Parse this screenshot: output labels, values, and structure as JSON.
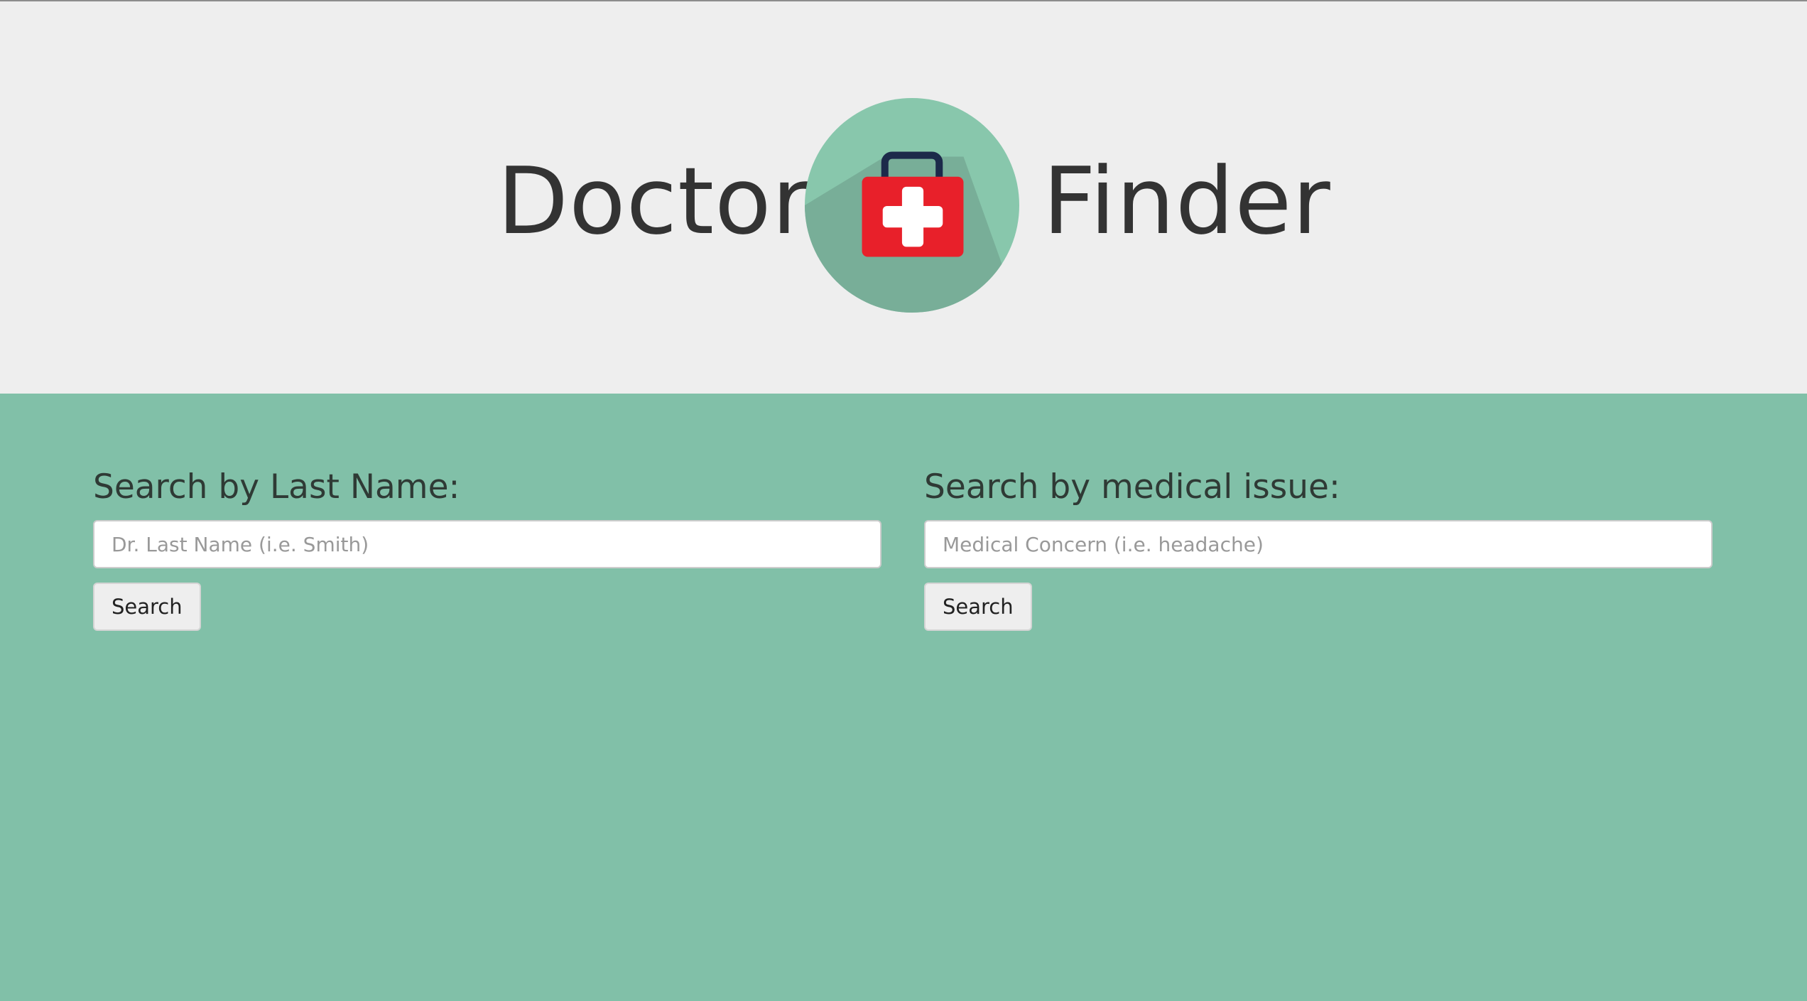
{
  "header": {
    "title_left": "Doctor",
    "title_right": "Finder",
    "logo_icon": "medical-kit-icon"
  },
  "colors": {
    "header_bg": "#eeeeee",
    "page_bg": "#81c0a8",
    "logo_circle": "#88c7ac",
    "kit_red": "#e8202a",
    "kit_handle": "#1a2a4a"
  },
  "search_last_name": {
    "label": "Search by Last Name:",
    "placeholder": "Dr. Last Name (i.e. Smith)",
    "value": "",
    "button_label": "Search"
  },
  "search_issue": {
    "label": "Search by medical issue:",
    "placeholder": "Medical Concern (i.e. headache)",
    "value": "",
    "button_label": "Search"
  }
}
